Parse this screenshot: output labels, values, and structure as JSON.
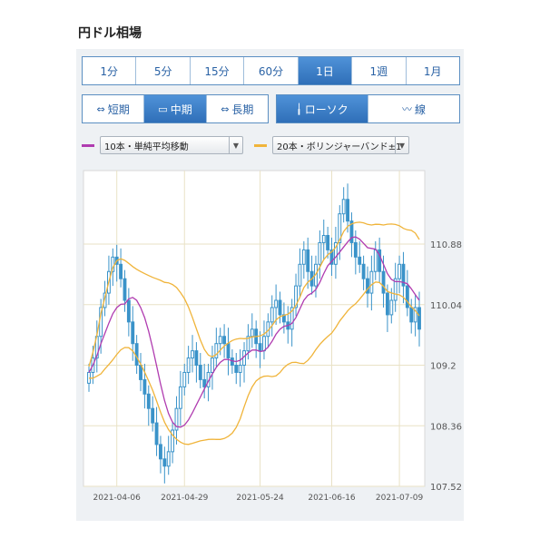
{
  "page": {
    "title": "円ドル相場"
  },
  "timeframes": [
    {
      "label": "1分",
      "active": false
    },
    {
      "label": "5分",
      "active": false
    },
    {
      "label": "15分",
      "active": false
    },
    {
      "label": "60分",
      "active": false
    },
    {
      "label": "1日",
      "active": true
    },
    {
      "label": "1週",
      "active": false
    },
    {
      "label": "1月",
      "active": false
    }
  ],
  "ranges": [
    {
      "label": "短期",
      "icon": "short-range-icon",
      "glyph": "⇔",
      "active": false
    },
    {
      "label": "中期",
      "icon": "mid-range-icon",
      "glyph": "▭",
      "active": true
    },
    {
      "label": "長期",
      "icon": "long-range-icon",
      "glyph": "⇔",
      "active": false
    }
  ],
  "chart_types": [
    {
      "label": "ローソク",
      "icon": "candlestick-icon",
      "glyph": "╽",
      "active": true
    },
    {
      "label": "線",
      "icon": "line-chart-icon",
      "glyph": "〰",
      "active": false
    }
  ],
  "indicators": {
    "ma": {
      "value": "10本・単純平均移動",
      "color": "#b03cb0"
    },
    "bb": {
      "value": "20本・ボリンジャーバンド±1",
      "color": "#f0b43a"
    }
  },
  "chart_data": {
    "type": "candlestick",
    "title": "",
    "xlabel": "",
    "ylabel": "",
    "y_ticks": [
      110.88,
      110.04,
      109.2,
      108.36,
      107.52
    ],
    "ylim": [
      107.52,
      111.9
    ],
    "x_ticks": [
      "2021-04-06",
      "2021-04-29",
      "2021-05-24",
      "2021-06-16",
      "2021-07-09"
    ],
    "x_tick_index": [
      7,
      24,
      43,
      61,
      78
    ],
    "grid": true,
    "closes": [
      109.1,
      109.3,
      109.6,
      110.0,
      110.2,
      110.5,
      110.7,
      110.6,
      110.4,
      110.1,
      109.8,
      109.5,
      109.2,
      109.0,
      108.8,
      108.6,
      108.4,
      108.1,
      107.9,
      107.8,
      108.0,
      108.3,
      108.6,
      108.9,
      109.1,
      109.3,
      109.4,
      109.2,
      109.0,
      108.9,
      109.1,
      109.3,
      109.5,
      109.6,
      109.5,
      109.3,
      109.2,
      109.1,
      109.2,
      109.4,
      109.6,
      109.7,
      109.5,
      109.4,
      109.6,
      109.8,
      110.0,
      110.1,
      109.9,
      109.8,
      109.7,
      110.0,
      110.3,
      110.6,
      110.8,
      110.5,
      110.3,
      110.6,
      110.9,
      111.0,
      110.8,
      110.6,
      110.9,
      111.3,
      111.5,
      111.2,
      110.9,
      110.7,
      110.6,
      110.4,
      110.2,
      110.5,
      110.8,
      110.5,
      110.2,
      109.9,
      110.1,
      110.4,
      110.6,
      110.3,
      110.0,
      109.8,
      110.0,
      109.7
    ],
    "sma10_color": "#b03cb0",
    "band_color": "#f0b43a",
    "candle_color": "#3a93c9"
  }
}
